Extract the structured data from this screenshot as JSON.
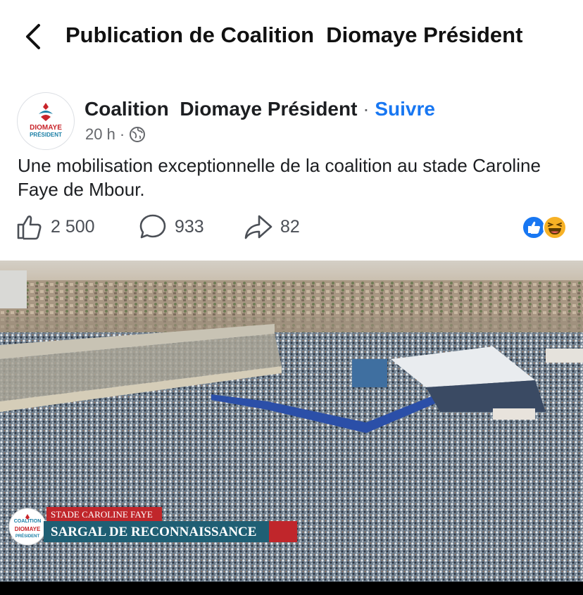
{
  "header": {
    "title": "Publication de Coalition  Diomaye Président",
    "back_icon": "chevron-left-icon"
  },
  "post": {
    "author": "Coalition  Diomaye Président",
    "separator": "·",
    "follow_label": "Suivre",
    "time": "20 h",
    "time_separator": "·",
    "audience_icon": "globe-icon",
    "avatar_text_line1": "DIOMAYE",
    "avatar_text_line2": "PRÉSIDENT",
    "caption": "Une mobilisation exceptionnelle de la coalition au stade Caroline Faye de Mbour.",
    "likes": "2 500",
    "comments": "933",
    "shares": "82",
    "reactions": [
      "like-reaction-icon",
      "haha-reaction-icon"
    ]
  },
  "photo": {
    "banner_top": "STADE CAROLINE FAYE",
    "banner_main": "SARGAL DE RECONNAISSANCE",
    "logo_top": "COALITION",
    "logo_mid": "DIOMAYE",
    "logo_bottom": "PRÉSIDENT"
  },
  "colors": {
    "accent": "#1877f2",
    "banner_red": "#c0262b",
    "banner_teal": "#1f5f74",
    "logo_red": "#c8242a",
    "logo_teal": "#1b7fa6"
  }
}
